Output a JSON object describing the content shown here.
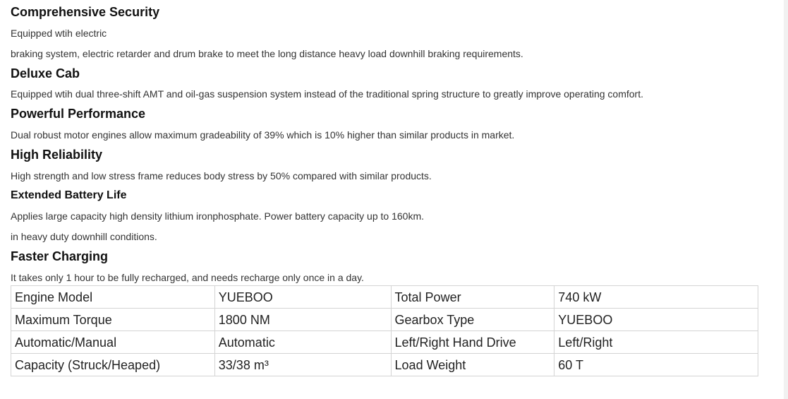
{
  "sections": [
    {
      "heading": "Comprehensive Security",
      "paragraphs": [
        "Equipped wtih electric",
        "braking system, electric retarder and drum brake to meet the long distance heavy load downhill braking requirements."
      ]
    },
    {
      "heading": "Deluxe Cab",
      "paragraphs": [
        "Equipped wtih dual three-shift AMT and oil-gas suspension system instead of the traditional spring structure to greatly improve operating comfort."
      ]
    },
    {
      "heading": "Powerful Performance",
      "paragraphs": [
        "Dual robust motor engines allow maximum gradeability of 39% which is 10% higher than similar products in market."
      ]
    },
    {
      "heading": "High Reliability",
      "paragraphs": [
        "High strength and low stress frame reduces body stress by 50% compared with similar products."
      ]
    },
    {
      "heading": "Extended Battery Life",
      "paragraphs": [
        "Applies large capacity high density lithium ironphosphate. Power battery capacity up to 160km.",
        "in heavy duty downhill conditions."
      ]
    },
    {
      "heading": "Faster Charging",
      "paragraphs": [
        "It takes only 1 hour to be fully recharged, and needs recharge only once in a day."
      ]
    }
  ],
  "specs": {
    "rows": [
      [
        "Engine Model",
        "YUEBOO",
        "Total Power",
        "740 kW"
      ],
      [
        "Maximum Torque",
        "1800 NM",
        "Gearbox Type",
        "YUEBOO"
      ],
      [
        "Automatic/Manual",
        "Automatic",
        "Left/Right Hand Drive",
        "Left/Right"
      ],
      [
        "Capacity (Struck/Heaped)",
        "33/38 m³",
        "Load Weight",
        "60 T"
      ]
    ]
  }
}
